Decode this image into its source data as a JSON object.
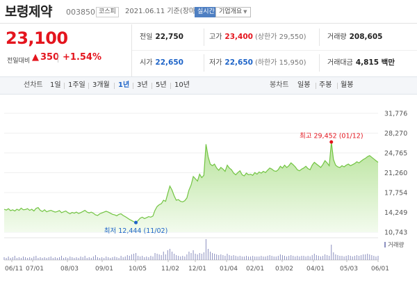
{
  "header": {
    "name": "보령제약",
    "code": "003850",
    "market": "코스피",
    "date": "2021.06.11 기준(장마감)",
    "realtime": "실시간",
    "company_info": "기업개요"
  },
  "price": {
    "current": "23,100",
    "change_label": "전일대비",
    "change": "350",
    "change_pct": "+1.54%"
  },
  "quotes": {
    "prev_label": "전일",
    "prev": "22,750",
    "high_label": "고가",
    "high": "23,400",
    "upper_limit": "(상한가 29,550)",
    "volume_label": "거래량",
    "volume": "208,605",
    "open_label": "시가",
    "open": "22,650",
    "low_label": "저가",
    "low": "22,650",
    "lower_limit": "(하한가 15,950)",
    "amount_label": "거래대금",
    "amount": "4,815 백만"
  },
  "tabs": {
    "line_label": "선차트",
    "line_items": [
      "1일",
      "1주일",
      "3개월",
      "1년",
      "3년",
      "5년",
      "10년"
    ],
    "active": "1년",
    "candle_label": "봉차트",
    "candle_items": [
      "일봉",
      "주봉",
      "월봉"
    ]
  },
  "colors": {
    "up": "#e4151e",
    "down": "#1e64c8",
    "line": "#72c442",
    "fill_top": "#b7e39a",
    "fill_bottom": "#f3fbee"
  },
  "chart_data": {
    "type": "area",
    "x_ticks": [
      "06/11",
      "07/01",
      "08/03",
      "09/01",
      "10/05",
      "11/02",
      "12/01",
      "01/04",
      "02/01",
      "03/02",
      "04/01",
      "05/03",
      "06/01"
    ],
    "y_ticks": [
      "31,776",
      "28,270",
      "24,765",
      "21,260",
      "17,754",
      "14,249",
      "10,743"
    ],
    "ylim": [
      10743,
      31776
    ],
    "volume_label": "거래량",
    "max_annotation": {
      "label": "최고",
      "value": "29,452",
      "date": "(01/12)"
    },
    "min_annotation": {
      "label": "최저",
      "value": "12,444",
      "date": "(11/02)"
    },
    "values": [
      14800,
      14650,
      14900,
      14550,
      14700,
      14500,
      14800,
      14600,
      15000,
      14700,
      14750,
      14900,
      14600,
      14800,
      14500,
      14950,
      15100,
      14600,
      14400,
      14700,
      14350,
      14500,
      14600,
      14450,
      14300,
      14400,
      14550,
      14200,
      14350,
      14500,
      14200,
      14000,
      14250,
      14100,
      14300,
      14050,
      14200,
      14400,
      14600,
      14300,
      14150,
      14300,
      14100,
      13800,
      13700,
      14000,
      14150,
      14300,
      14450,
      14300,
      14100,
      13900,
      13800,
      13650,
      13900,
      14000,
      13700,
      13500,
      13250,
      13000,
      12800,
      12600,
      12444,
      12800,
      13200,
      13400,
      13150,
      13300,
      13500,
      13400,
      13600,
      14600,
      15300,
      15600,
      15800,
      16400,
      16200,
      17600,
      18900,
      18200,
      17200,
      16400,
      16500,
      16200,
      16100,
      16300,
      16800,
      18200,
      19100,
      20600,
      20200,
      19800,
      21000,
      20400,
      20800,
      26300,
      24100,
      22800,
      22500,
      22800,
      22100,
      21700,
      22200,
      21900,
      21500,
      22600,
      22100,
      21800,
      21200,
      20900,
      21300,
      21600,
      20900,
      20700,
      21200,
      20900,
      21000,
      20800,
      21300,
      21000,
      21400,
      21200,
      21500,
      21300,
      21700,
      22100,
      21900,
      21600,
      21500,
      21800,
      22400,
      22100,
      22600,
      22200,
      22500,
      23000,
      22700,
      22300,
      21800,
      21600,
      21900,
      22100,
      22400,
      22000,
      21800,
      22600,
      23100,
      22800,
      22500,
      22200,
      22700,
      23400,
      23000,
      22500,
      26700,
      23600,
      22600,
      22300,
      22200,
      22500,
      22300,
      22600,
      22800,
      22500,
      22700,
      22900,
      23200,
      23000,
      23300,
      23600,
      23800,
      24100,
      24300,
      24000,
      23700,
      23400,
      23100
    ],
    "volume": [
      4,
      3,
      5,
      3,
      4,
      6,
      3,
      4,
      3,
      5,
      4,
      3,
      4,
      3,
      5,
      6,
      3,
      4,
      3,
      4,
      3,
      4,
      5,
      3,
      4,
      3,
      4,
      6,
      3,
      4,
      3,
      5,
      4,
      3,
      4,
      3,
      5,
      4,
      6,
      3,
      4,
      3,
      5,
      7,
      4,
      3,
      4,
      3,
      5,
      4,
      3,
      4,
      5,
      4,
      3,
      6,
      4,
      5,
      7,
      6,
      8,
      9,
      10,
      6,
      5,
      6,
      4,
      5,
      4,
      6,
      5,
      10,
      9,
      8,
      7,
      12,
      8,
      14,
      16,
      12,
      9,
      7,
      6,
      5,
      6,
      5,
      8,
      12,
      10,
      14,
      9,
      8,
      10,
      9,
      11,
      30,
      16,
      12,
      10,
      9,
      8,
      7,
      8,
      7,
      6,
      9,
      7,
      6,
      7,
      6,
      5,
      6,
      5,
      5,
      6,
      5,
      5,
      6,
      5,
      5,
      5,
      6,
      5,
      5,
      6,
      7,
      6,
      5,
      5,
      6,
      8,
      7,
      6,
      5,
      6,
      7,
      6,
      5,
      6,
      5,
      6,
      6,
      5,
      6,
      5,
      7,
      9,
      7,
      6,
      5,
      6,
      8,
      7,
      6,
      22,
      11,
      8,
      7,
      6,
      6,
      5,
      6,
      7,
      6,
      5,
      6,
      7,
      6,
      7,
      8,
      8,
      9,
      8,
      7,
      6,
      5,
      6
    ]
  }
}
